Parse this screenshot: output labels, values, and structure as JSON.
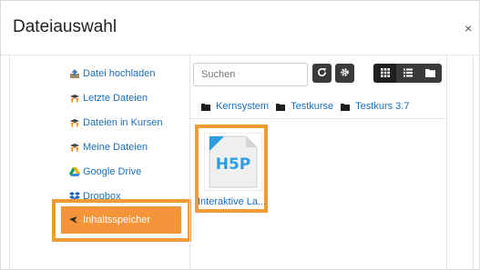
{
  "dialog": {
    "title": "Dateiauswahl",
    "close_glyph": "×"
  },
  "sidebar": {
    "items": [
      {
        "label": "Datei hochladen",
        "icon": "upload-icon"
      },
      {
        "label": "Letzte Dateien",
        "icon": "moodle-icon"
      },
      {
        "label": "Dateien in Kursen",
        "icon": "moodle-icon"
      },
      {
        "label": "Meine Dateien",
        "icon": "moodle-icon"
      },
      {
        "label": "Google Drive",
        "icon": "google-drive-icon"
      },
      {
        "label": "Dropbox",
        "icon": "dropbox-icon"
      }
    ],
    "active": {
      "label": "Inhaltsspeicher",
      "icon": "content-bank-icon"
    }
  },
  "toolbar": {
    "search_placeholder": "Suchen",
    "refresh_icon": "refresh-icon",
    "settings_icon": "gear-icon",
    "views": [
      "grid-view-icon",
      "list-view-icon",
      "tree-view-icon"
    ]
  },
  "path": [
    {
      "label": "Kernsystem",
      "icon": "folder-icon"
    },
    {
      "label": "Testkurse",
      "icon": "folder-icon"
    },
    {
      "label": "Testkurs 3.7",
      "icon": "folder-icon"
    }
  ],
  "files": [
    {
      "name": "Interaktive La...",
      "icon": "h5p-file-icon"
    }
  ],
  "colors": {
    "accent": "#f4953b",
    "link": "#1a6fb5",
    "highlight_border": "#f19a38",
    "button_dark": "#3a3a3a"
  }
}
